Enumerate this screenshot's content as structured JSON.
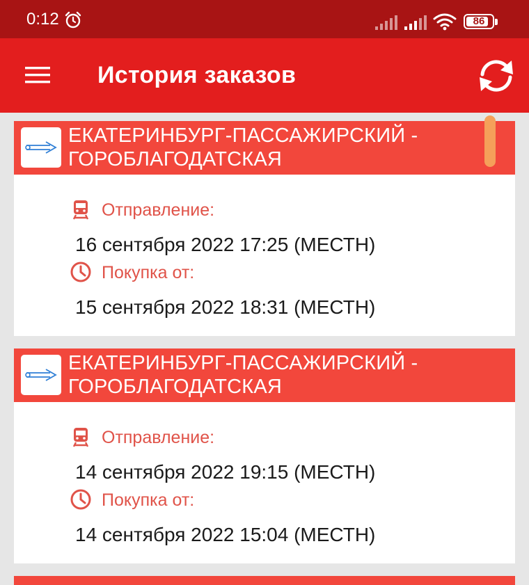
{
  "status_bar": {
    "time": "0:12",
    "battery": "86",
    "battery_level": 0.86
  },
  "app_bar": {
    "title": "История заказов",
    "menu_icon": "hamburger-menu-icon",
    "refresh_icon": "refresh-icon"
  },
  "colors": {
    "status_bar": "#a81414",
    "app_bar": "#e31e1e",
    "card_header": "#f2473c",
    "label": "#e05349",
    "background": "#e6e6e6"
  },
  "orders": [
    {
      "route": "ЕКАТЕРИНБУРГ-ПАССАЖИРСКИЙ - ГОРОБЛАГОДАТСКАЯ",
      "departure_label": "Отправление:",
      "departure": "16 сентября 2022 17:25 (МЕСТН)",
      "purchase_label": "Покупка от:",
      "purchase": "15 сентября 2022 18:31 (МЕСТН)"
    },
    {
      "route": "ЕКАТЕРИНБУРГ-ПАССАЖИРСКИЙ - ГОРОБЛАГОДАТСКАЯ",
      "departure_label": "Отправление:",
      "departure": "14 сентября 2022 19:15 (МЕСТН)",
      "purchase_label": "Покупка от:",
      "purchase": "14 сентября 2022 15:04 (МЕСТН)"
    }
  ]
}
